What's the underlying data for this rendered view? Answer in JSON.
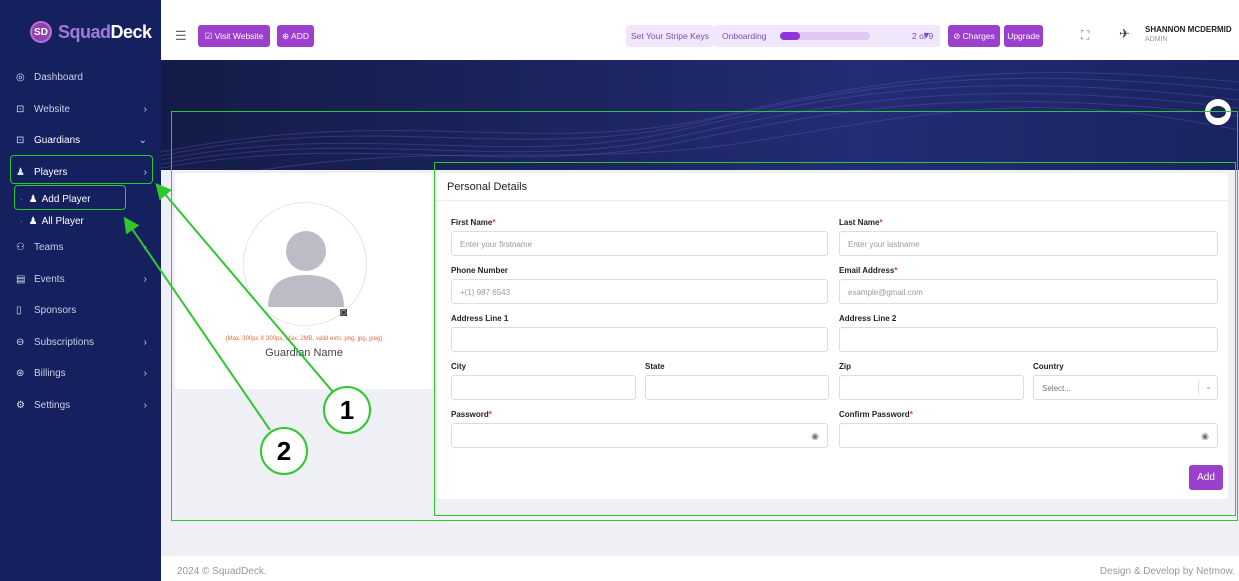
{
  "brand": {
    "logo_text_a": "Squad",
    "logo_text_b": "Deck",
    "logo_mark": "SD"
  },
  "sidebar": {
    "items": [
      {
        "label": "Dashboard",
        "icon": "dashboard-icon",
        "glyph": "◎"
      },
      {
        "label": "Website",
        "icon": "website-icon",
        "glyph": "⊡",
        "chev": "›"
      },
      {
        "label": "Guardians",
        "icon": "guardians-icon",
        "glyph": "⊡",
        "chev": "⌄"
      },
      {
        "label": "Players",
        "icon": "player-icon",
        "glyph": "♟",
        "chev": "›"
      },
      {
        "label": "Teams",
        "icon": "teams-icon",
        "glyph": "⚇",
        "chev": "›"
      },
      {
        "label": "Events",
        "icon": "calendar-icon",
        "glyph": "▤",
        "chev": "›"
      },
      {
        "label": "Sponsors",
        "icon": "sponsor-icon",
        "glyph": "▯"
      },
      {
        "label": "Subscriptions",
        "icon": "subscriptions-icon",
        "glyph": "⊖",
        "chev": "›"
      },
      {
        "label": "Billings",
        "icon": "billing-icon",
        "glyph": "⊛",
        "chev": "›"
      },
      {
        "label": "Settings",
        "icon": "gear-icon",
        "glyph": "⚙",
        "chev": "›"
      }
    ],
    "sub_items": [
      {
        "label": "Add Player"
      },
      {
        "label": "All Player"
      }
    ]
  },
  "topbar": {
    "visit_website": "☑ Visit Website",
    "add": "⊕ ADD",
    "stripe": "Set Your Stripe Keys",
    "onboarding": "Onboarding",
    "onboarding_step": "2 of 9",
    "onboarding_progress": 0.22,
    "charges": "⊘ Charges",
    "upgrade": "Upgrade",
    "user_name": "SHANNON MCDERMID",
    "user_role": "ADMIN"
  },
  "profile": {
    "hint": "(Max. 300px X 300px, Max. 2MB, valid exts: png, jpg, jpeg)",
    "guardian_name": "Guardian Name"
  },
  "form": {
    "title": "Personal Details",
    "first_name_label": "First Name",
    "first_name_placeholder": "Enter your firstname",
    "last_name_label": "Last Name",
    "last_name_placeholder": "Enter your lastname",
    "phone_label": "Phone Number",
    "phone_placeholder": "+(1) 987 6543",
    "email_label": "Email Address",
    "email_placeholder": "example@gmail.com",
    "address1_label": "Address Line 1",
    "address2_label": "Address Line 2",
    "city_label": "City",
    "state_label": "State",
    "zip_label": "Zip",
    "country_label": "Country",
    "country_value": "Select...",
    "password_label": "Password",
    "confirm_password_label": "Confirm Password",
    "required_mark": "*",
    "add_label": "Add"
  },
  "footer": {
    "left": "2024 © SquadDeck.",
    "right": "Design & Develop by Netmow."
  },
  "annotations": {
    "one": "1",
    "two": "2"
  },
  "colors": {
    "sidebar": "#15205e",
    "accent": "#9b3fcd",
    "highlight": "#2ec82e"
  }
}
